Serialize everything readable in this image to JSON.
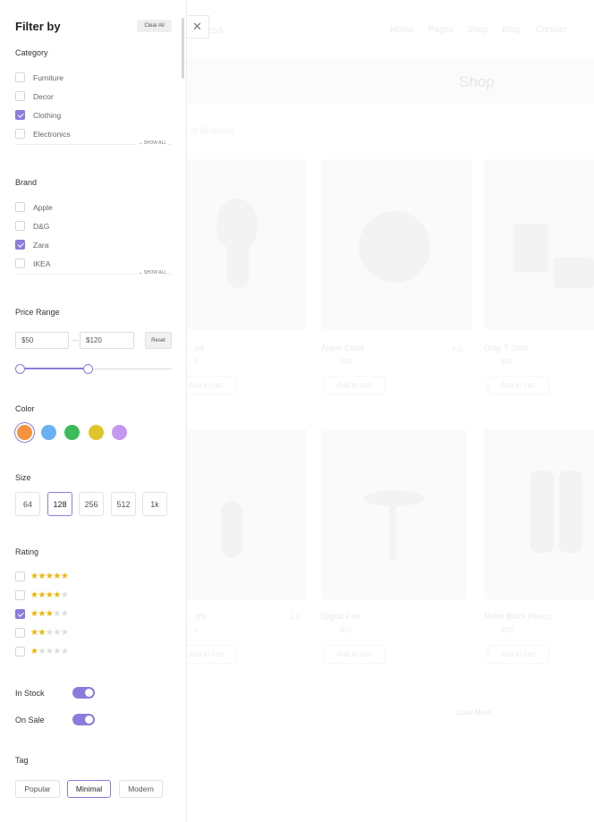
{
  "background_page": {
    "brand_suffix": "ness",
    "nav": [
      "Home",
      "Pages",
      "Shop",
      "Blog",
      "Contact"
    ],
    "hero_title": "Shop",
    "result_text": "of 28 results",
    "load_more": "Load More",
    "add_to_cart": "Add to cart",
    "products": [
      {
        "name": "…ad",
        "price": "…0",
        "rating": ""
      },
      {
        "name": "Alarm Clock",
        "price": "$55",
        "rating": "4.5"
      },
      {
        "name": "Gray T-Shirt",
        "price": "$42",
        "rating": ""
      },
      {
        "name": "…ght",
        "price": "…0",
        "rating": "4.0"
      },
      {
        "name": "Digital Pen",
        "price": "$15",
        "rating": ""
      },
      {
        "name": "Matte Black Pooco",
        "price": "$28",
        "rating": ""
      }
    ]
  },
  "sidebar": {
    "title": "Filter by",
    "clear_all": "Clear All",
    "close_glyph": "✕",
    "show_all": "⌄ SHOW ALL",
    "category": {
      "title": "Category",
      "items": [
        {
          "label": "Furniture",
          "checked": false
        },
        {
          "label": "Decor",
          "checked": false
        },
        {
          "label": "Clothing",
          "checked": true
        },
        {
          "label": "Electronics",
          "checked": false
        }
      ]
    },
    "brand": {
      "title": "Brand",
      "items": [
        {
          "label": "Apple",
          "checked": false
        },
        {
          "label": "D&G",
          "checked": false
        },
        {
          "label": "Zara",
          "checked": true
        },
        {
          "label": "IKEA",
          "checked": false
        }
      ]
    },
    "price": {
      "title": "Price Range",
      "min": "$50",
      "max": "$120",
      "separator": "—",
      "reset": "Reset",
      "range_fraction": [
        0.0,
        0.45
      ]
    },
    "color": {
      "title": "Color",
      "swatches": [
        {
          "name": "orange",
          "hex": "#f5923e",
          "selected": true
        },
        {
          "name": "blue",
          "hex": "#6ab0f3",
          "selected": false
        },
        {
          "name": "green",
          "hex": "#3dba5a",
          "selected": false
        },
        {
          "name": "yellow",
          "hex": "#e0c42c",
          "selected": false
        },
        {
          "name": "purple",
          "hex": "#c497f5",
          "selected": false
        }
      ]
    },
    "size": {
      "title": "Size",
      "options": [
        {
          "label": "64",
          "selected": false
        },
        {
          "label": "128",
          "selected": true
        },
        {
          "label": "256",
          "selected": false
        },
        {
          "label": "512",
          "selected": false
        },
        {
          "label": "1k",
          "selected": false
        }
      ]
    },
    "rating": {
      "title": "Rating",
      "options": [
        {
          "stars": 5,
          "checked": false
        },
        {
          "stars": 4,
          "checked": false
        },
        {
          "stars": 3,
          "checked": true
        },
        {
          "stars": 2,
          "checked": false
        },
        {
          "stars": 1,
          "checked": false
        }
      ]
    },
    "in_stock": {
      "label": "In Stock",
      "on": true
    },
    "on_sale": {
      "label": "On Sale",
      "on": true
    },
    "tag": {
      "title": "Tag",
      "options": [
        {
          "label": "Popular",
          "selected": false
        },
        {
          "label": "Minimal",
          "selected": true
        },
        {
          "label": "Modern",
          "selected": false
        }
      ]
    },
    "accent_color": "#8c7bdc"
  }
}
